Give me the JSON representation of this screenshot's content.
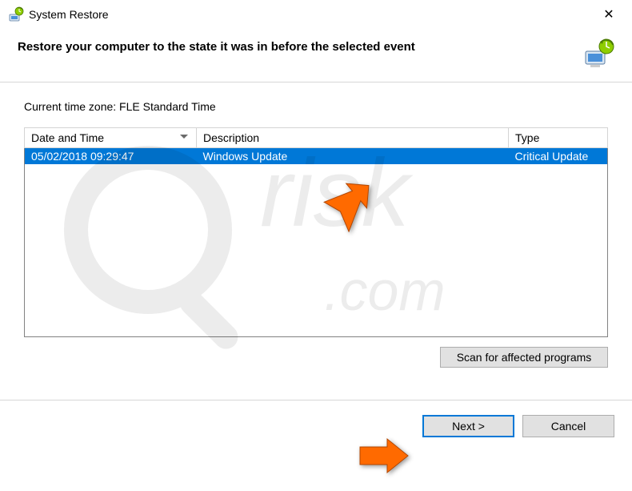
{
  "window": {
    "title": "System Restore",
    "close_symbol": "✕"
  },
  "header": {
    "heading": "Restore your computer to the state it was in before the selected event"
  },
  "content": {
    "timezone_label": "Current time zone: FLE Standard Time",
    "columns": {
      "date": "Date and Time",
      "description": "Description",
      "type": "Type"
    },
    "rows": [
      {
        "datetime": "05/02/2018 09:29:47",
        "description": "Windows Update",
        "type": "Critical Update"
      }
    ],
    "scan_button": "Scan for affected programs"
  },
  "footer": {
    "next": "Next >",
    "cancel": "Cancel"
  },
  "icons": {
    "restore": "restore-icon",
    "close": "close-icon",
    "header": "system-restore-header-icon"
  },
  "annotations": {
    "arrow_on_row": true,
    "arrow_on_next": true
  }
}
